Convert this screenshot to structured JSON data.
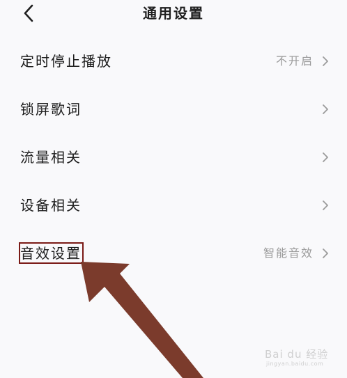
{
  "header": {
    "title": "通用设置"
  },
  "settings": {
    "items": [
      {
        "label": "定时停止播放",
        "value": "不开启"
      },
      {
        "label": "锁屏歌词",
        "value": ""
      },
      {
        "label": "流量相关",
        "value": ""
      },
      {
        "label": "设备相关",
        "value": ""
      },
      {
        "label": "音效设置",
        "value": "智能音效"
      }
    ]
  },
  "colors": {
    "background": "#f9f9fb",
    "annotation": "#7a1a16",
    "arrow": "#7b3b2c",
    "value_text": "#9a9a9a"
  },
  "watermark": {
    "text": "Bai du 经验",
    "sub": "jingyan.baidu.com"
  }
}
